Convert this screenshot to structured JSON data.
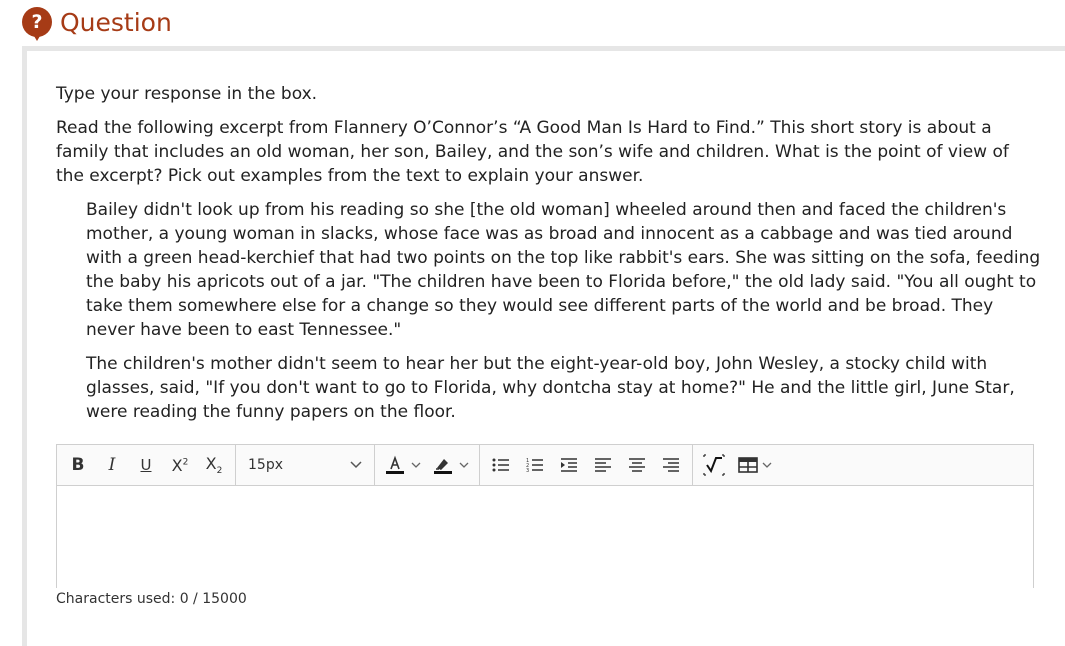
{
  "header": {
    "title": "Question",
    "badge": "?"
  },
  "instruction": "Type your response in the box.",
  "prompt": "Read the following excerpt from Flannery O’Connor’s “A Good Man Is Hard to Find.” This short story is about a family that includes an old woman, her son, Bailey, and the son’s wife and children. What is the point of view of the excerpt? Pick out examples from the text to explain your answer.",
  "excerpt": [
    "Bailey didn't look up from his reading so she [the old woman] wheeled around then and faced the children's mother, a young woman in slacks, whose face was as broad and innocent as a cabbage and was tied around with a green head-kerchief that had two points on the top like rabbit's ears. She was sitting on the sofa, feeding the baby his apricots out of a jar. \"The children have been to Florida before,\" the old lady said. \"You all ought to take them somewhere else for a change so they would see different parts of the world and be broad. They never have been to east Tennessee.\"",
    "The children's mother didn't seem to hear her but the eight-year-old boy, John Wesley, a stocky child with glasses, said, \"If you don't want to go to Florida, why dontcha stay at home?\" He and the little girl, June Star, were reading the funny papers on the floor."
  ],
  "toolbar": {
    "font_size": "15px",
    "icons": [
      "bold-icon",
      "italic-icon",
      "underline-icon",
      "superscript-icon",
      "subscript-icon",
      "font-color-icon",
      "highlight-icon",
      "bullet-list-icon",
      "numbered-list-icon",
      "indent-icon",
      "align-left-icon",
      "align-center-icon",
      "align-right-icon",
      "math-icon",
      "table-icon"
    ],
    "colors": {
      "accent": "#a63b16",
      "border": "#cfcfcf"
    }
  },
  "counter": "Characters used: 0 / 15000"
}
